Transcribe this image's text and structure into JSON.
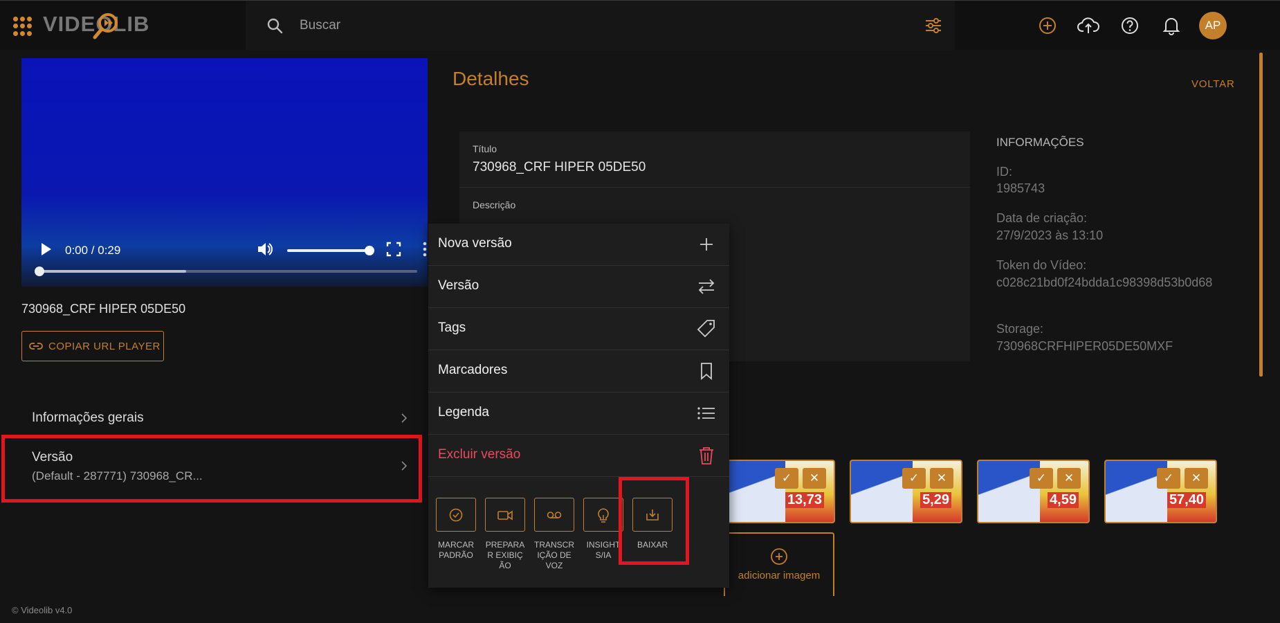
{
  "header": {
    "logo_text": "VIDEOLIB",
    "search_placeholder": "Buscar",
    "avatar_initials": "AP"
  },
  "player": {
    "time": "0:00 / 0:29",
    "progress_fraction": 0.0,
    "buffered_fraction": 0.39,
    "volume_fraction": 1.0
  },
  "video_title": "730968_CRF HIPER 05DE50",
  "copy_url_label": "COPIAR URL PLAYER",
  "sidebar": {
    "items": [
      {
        "label": "Informações gerais",
        "sub": ""
      },
      {
        "label": "Versão",
        "sub": "(Default - 287771) 730968_CR..."
      }
    ]
  },
  "details": {
    "title": "Detalhes",
    "back_label": "VOLTAR",
    "title_label": "Título",
    "title_value": "730968_CRF HIPER 05DE50",
    "description_label": "Descrição"
  },
  "info": {
    "heading": "INFORMAÇÕES",
    "id_label": "ID:",
    "id_value": "1985743",
    "created_label": "Data de criação:",
    "created_value": "27/9/2023 às 13:10",
    "token_label": "Token do Vídeo:",
    "token_value": "c028c21bd0f24bdda1c98398d53b0d68",
    "storage_label": "Storage:",
    "storage_value": "730968CRFHIPER05DE50MXF"
  },
  "menu": {
    "items": [
      {
        "label": "Nova versão",
        "icon": "plus-icon"
      },
      {
        "label": "Versão",
        "icon": "swap-icon"
      },
      {
        "label": "Tags",
        "icon": "tag-icon"
      },
      {
        "label": "Marcadores",
        "icon": "bookmark-icon"
      },
      {
        "label": "Legenda",
        "icon": "list-icon"
      },
      {
        "label": "Excluir versão",
        "icon": "trash-icon"
      }
    ],
    "actions": [
      {
        "label": "MARCAR PADRÃO",
        "icon": "check-circle-icon"
      },
      {
        "label": "PREPARAR EXIBIÇÃO",
        "icon": "video-camera-icon"
      },
      {
        "label": "TRANSCRIÇÃO DE VOZ",
        "icon": "voicemail-icon"
      },
      {
        "label": "INSIGHTS/IA",
        "icon": "lightbulb-icon"
      },
      {
        "label": "BAIXAR",
        "icon": "download-icon"
      }
    ]
  },
  "thumbnails": [
    {
      "price": "13,73"
    },
    {
      "price": "5,29"
    },
    {
      "price": "4,59"
    },
    {
      "price": "57,40"
    }
  ],
  "add_image_label": "adicionar imagem",
  "footer": "© Videolib v4.0",
  "colors": {
    "accent": "#c47f2a",
    "danger": "#e84a5f",
    "highlight": "#e3161d"
  }
}
